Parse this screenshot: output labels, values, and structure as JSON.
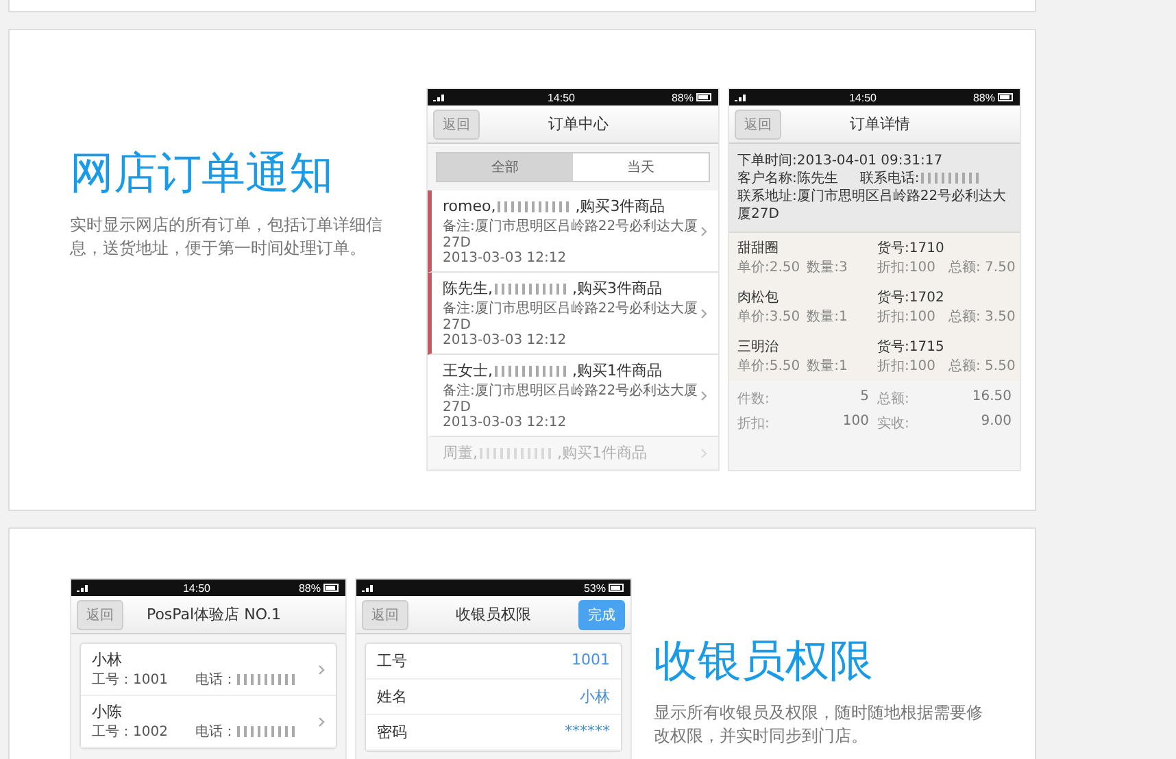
{
  "sections": [
    {
      "phones_first": false,
      "title": "网店订单通知",
      "description": "实时显示网店的所有订单，包括订单详细信息，送货地址，便于第一时间处理订单。",
      "phones": [
        {
          "kind": "order_list",
          "time": "14:50",
          "battery": "88%",
          "back": "返回",
          "title": "订单中心",
          "segments": [
            {
              "label": "全部",
              "selected": true
            },
            {
              "label": "当天",
              "selected": false
            }
          ],
          "orders": [
            {
              "customer": "romeo,",
              "summary": ",购买3件商品",
              "note": "备注:厦门市思明区吕岭路22号必利达大厦27D",
              "time": "2013-03-03 12:12",
              "unread": true,
              "dimmed": false
            },
            {
              "customer": "陈先生,",
              "summary": ",购买3件商品",
              "note": "备注:厦门市思明区吕岭路22号必利达大厦27D",
              "time": "2013-03-03 12:12",
              "unread": true,
              "dimmed": false
            },
            {
              "customer": "王女士,",
              "summary": ",购买1件商品",
              "note": "备注:厦门市思明区吕岭路22号必利达大厦27D",
              "time": "2013-03-03 12:12",
              "unread": false,
              "dimmed": false
            },
            {
              "customer": "周董,",
              "summary": ",购买1件商品",
              "unread": false,
              "dimmed": true
            }
          ]
        },
        {
          "kind": "order_detail",
          "time": "14:50",
          "battery": "88%",
          "back": "返回",
          "title": "订单详情",
          "order_time": "下单时间:2013-04-01 09:31:17",
          "customer": "客户名称:陈先生",
          "phone_label": "联系电话:",
          "address": "联系地址:厦门市思明区吕岭路22号必利达大厦27D",
          "items": [
            {
              "name": "甜甜圈",
              "code": "货号:1710",
              "price": "单价:2.50",
              "qty": "数量:3",
              "discount": "折扣:100",
              "total": "总额: 7.50"
            },
            {
              "name": "肉松包",
              "code": "货号:1702",
              "price": "单价:3.50",
              "qty": "数量:1",
              "discount": "折扣:100",
              "total": "总额: 3.50"
            },
            {
              "name": "三明治",
              "code": "货号:1715",
              "price": "单价:5.50",
              "qty": "数量:1",
              "discount": "折扣:100",
              "total": "总额: 5.50"
            }
          ],
          "summary": [
            {
              "label": "件数:",
              "value": "5"
            },
            {
              "label": "总额:",
              "value": "16.50"
            },
            {
              "label": "折扣:",
              "value": "100"
            },
            {
              "label": "实收:",
              "value": "9.00"
            }
          ]
        }
      ]
    },
    {
      "phones_first": true,
      "title": "收银员权限",
      "description": "显示所有收银员及权限，随时随地根据需要修改权限，并实时同步到门店。",
      "phones": [
        {
          "kind": "staff_list",
          "time": "14:50",
          "battery": "88%",
          "back": "返回",
          "title": "PosPal体验店 NO.1",
          "staff": [
            {
              "name": "小林",
              "id": "工号：1001",
              "phone_label": "电话："
            },
            {
              "name": "小陈",
              "id": "工号：1002",
              "phone_label": "电话："
            }
          ]
        },
        {
          "kind": "staff_permission",
          "battery": "53%",
          "back": "返回",
          "title": "收银员权限",
          "done": "完成",
          "fields": [
            {
              "label": "工号",
              "value": "1001"
            },
            {
              "label": "姓名",
              "value": "小林"
            },
            {
              "label": "密码",
              "value": "******"
            }
          ]
        }
      ]
    }
  ]
}
